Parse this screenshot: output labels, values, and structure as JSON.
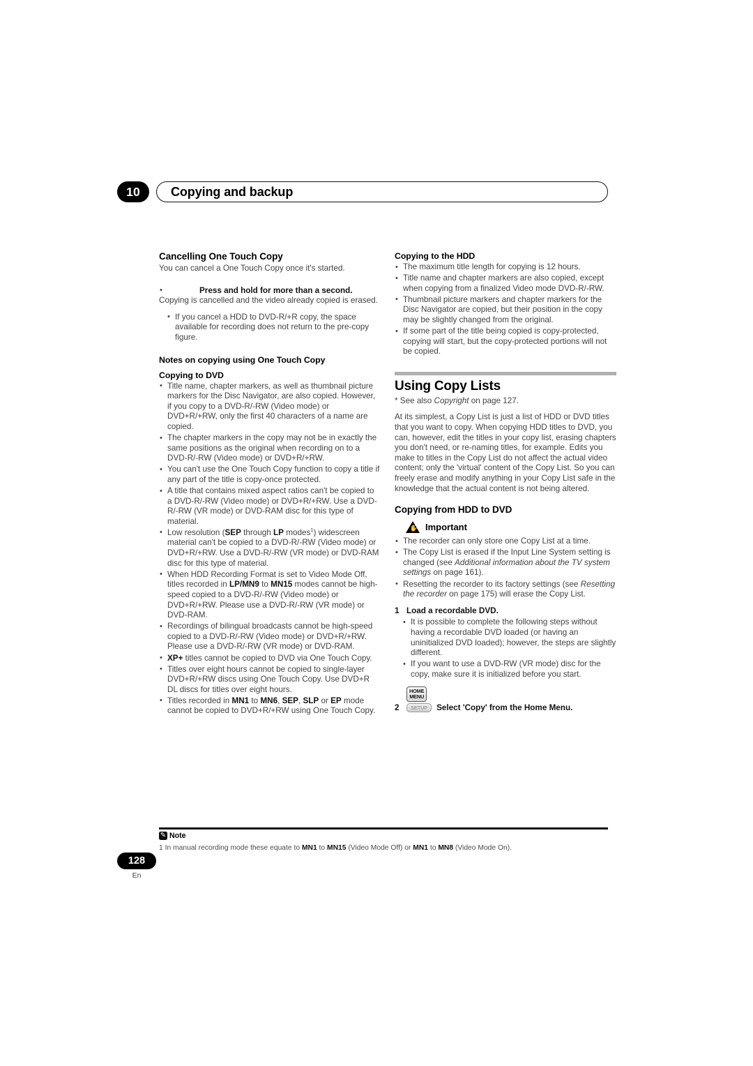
{
  "header": {
    "chapter_number": "10",
    "chapter_title": "Copying and backup"
  },
  "left_column": {
    "section_title": "Cancelling One Touch Copy",
    "intro": "You can cancel a One Touch Copy once it's started.",
    "press_bullet": {
      "button_icon": "one-touch-copy-key",
      "label": "Press and hold for more than a second."
    },
    "press_body": "Copying is cancelled and the video already copied is erased.",
    "press_subbullets": [
      "If you cancel a HDD to DVD-R/+R copy, the space available for recording does not return to the pre-copy figure."
    ],
    "notes_title": "Notes on copying using One Touch Copy",
    "copying_to_dvd_title": "Copying to DVD",
    "copying_to_dvd_bullets": [
      "Title name, chapter markers, as well as thumbnail picture markers for the Disc Navigator, are also copied. However, if you copy to a DVD-R/-RW (Video mode) or DVD+R/+RW, only the first 40 characters of a name are copied.",
      "The chapter markers in the copy may not be in exactly the same positions as the original when recording on to a DVD-R/-RW (Video mode) or DVD+R/+RW.",
      "You can't use the One Touch Copy function to copy a title if any part of the title is copy-once protected.",
      "A title that contains mixed aspect ratios can't be copied to a DVD-R/-RW (Video mode) or DVD+R/+RW. Use a DVD-R/-RW (VR mode) or DVD-RAM disc for this type of material."
    ],
    "bullet_low_res": {
      "prefix": "Low resolution (",
      "bold1": "SEP",
      "mid": " through ",
      "bold2": "LP",
      "suffix_before_sup": " modes",
      "sup": "1",
      "suffix": ") widescreen material can't be copied to a DVD-R/-RW (Video mode) or DVD+R/+RW. Use a DVD-R/-RW (VR mode) or DVD-RAM disc for this type of material."
    },
    "bullet_hdd_format": {
      "prefix": "When HDD Recording Format is set to Video Mode Off, titles recorded in ",
      "bold1": "LP",
      "sep1": "/",
      "bold2": "MN9",
      "mid": " to ",
      "bold3": "MN15",
      "suffix": " modes cannot be high-speed copied to a DVD-R/-RW (Video mode) or DVD+R/+RW. Please use a DVD-R/-RW (VR mode) or DVD-RAM."
    },
    "bullet_bilingual": "Recordings of bilingual broadcasts cannot be high-speed copied to a DVD-R/-RW (Video mode) or DVD+R/+RW. Please use a DVD-R/-RW (VR mode) or DVD-RAM.",
    "bullet_xpplus": {
      "bold1": "XP+",
      "suffix": " titles cannot be copied to DVD via One Touch Copy."
    },
    "bullet_eight_hours": "Titles over eight hours cannot be copied to single-layer DVD+R/+RW discs using One Touch Copy. Use DVD+R DL discs for titles over eight hours.",
    "bullet_modes": {
      "prefix": "Titles recorded in ",
      "bold1": "MN1",
      "mid1": " to ",
      "bold2": "MN6",
      "mid2": ", ",
      "bold3": "SEP",
      "mid3": ", ",
      "bold4": "SLP",
      "mid4": " or ",
      "bold5": "EP",
      "suffix": " mode cannot be copied to DVD+R/+RW using One Touch Copy."
    }
  },
  "right_column": {
    "copying_to_hdd_title": "Copying to the HDD",
    "copying_to_hdd_bullets": [
      "The maximum title length for copying is 12 hours.",
      "Title name and chapter markers are also copied, except when copying from a finalized Video mode DVD-R/-RW.",
      "Thumbnail picture markers and chapter markers for the Disc Navigator are copied, but their position in the copy may be slightly changed from the original.",
      "If some part of the title being copied is copy-protected, copying will start, but the copy-protected portions will not be copied."
    ],
    "using_copy_lists_title": "Using Copy Lists",
    "see_also": {
      "prefix": "* See also ",
      "italic": "Copyright",
      "suffix": " on page 127."
    },
    "copy_lists_body": "At its simplest, a Copy List is just a list of HDD or DVD titles that you want to copy. When copying HDD titles to DVD, you can, however, edit the titles in your copy list, erasing chapters you don't need, or re-naming titles, for example. Edits you make to titles in the Copy List do not affect the actual video content; only the 'virtual' content of the Copy List. So you can freely erase and modify anything in your Copy List safe in the knowledge that the actual content is not being altered.",
    "copying_hdd_to_dvd_title": "Copying from HDD to DVD",
    "important_label": "Important",
    "important_icon": "warning-triangle-icon",
    "important_bullets": [
      "The recorder can only store one Copy List at a time."
    ],
    "important_bullet_input_line": {
      "prefix": "The Copy List is erased if the Input Line System setting is changed (see ",
      "italic": "Additional information about the TV system settings",
      "suffix": " on page 161)."
    },
    "important_bullet_reset": {
      "prefix": "Resetting the recorder to its factory settings (see ",
      "italic": "Resetting the recorder",
      "suffix": " on page 175) will erase the Copy List."
    },
    "step1": {
      "number": "1",
      "text": "Load a recordable DVD."
    },
    "step1_bullets": [
      "It is possible to complete the following steps without having a recordable DVD loaded (or having an uninitialized DVD loaded); however, the steps are slightly different.",
      "If you want to use a DVD-RW (VR mode) disc for the copy, make sure it is initialized before you start."
    ],
    "step2": {
      "number": "2",
      "key_home_line1": "HOME",
      "key_home_line2": "MENU",
      "key_setup": "SETUP",
      "text": "Select 'Copy' from the Home Menu."
    }
  },
  "footer": {
    "note_label": "Note",
    "note_icon": "pencil-note-icon",
    "note_text": {
      "prefix": "1 In manual recording mode these equate to ",
      "bold1": "MN1",
      "mid1": " to ",
      "bold2": "MN15",
      "mid2": " (Video Mode Off) or ",
      "bold3": "MN1",
      "mid3": " to ",
      "bold4": "MN8",
      "suffix": " (Video Mode On)."
    },
    "page_number": "128",
    "language": "En"
  }
}
